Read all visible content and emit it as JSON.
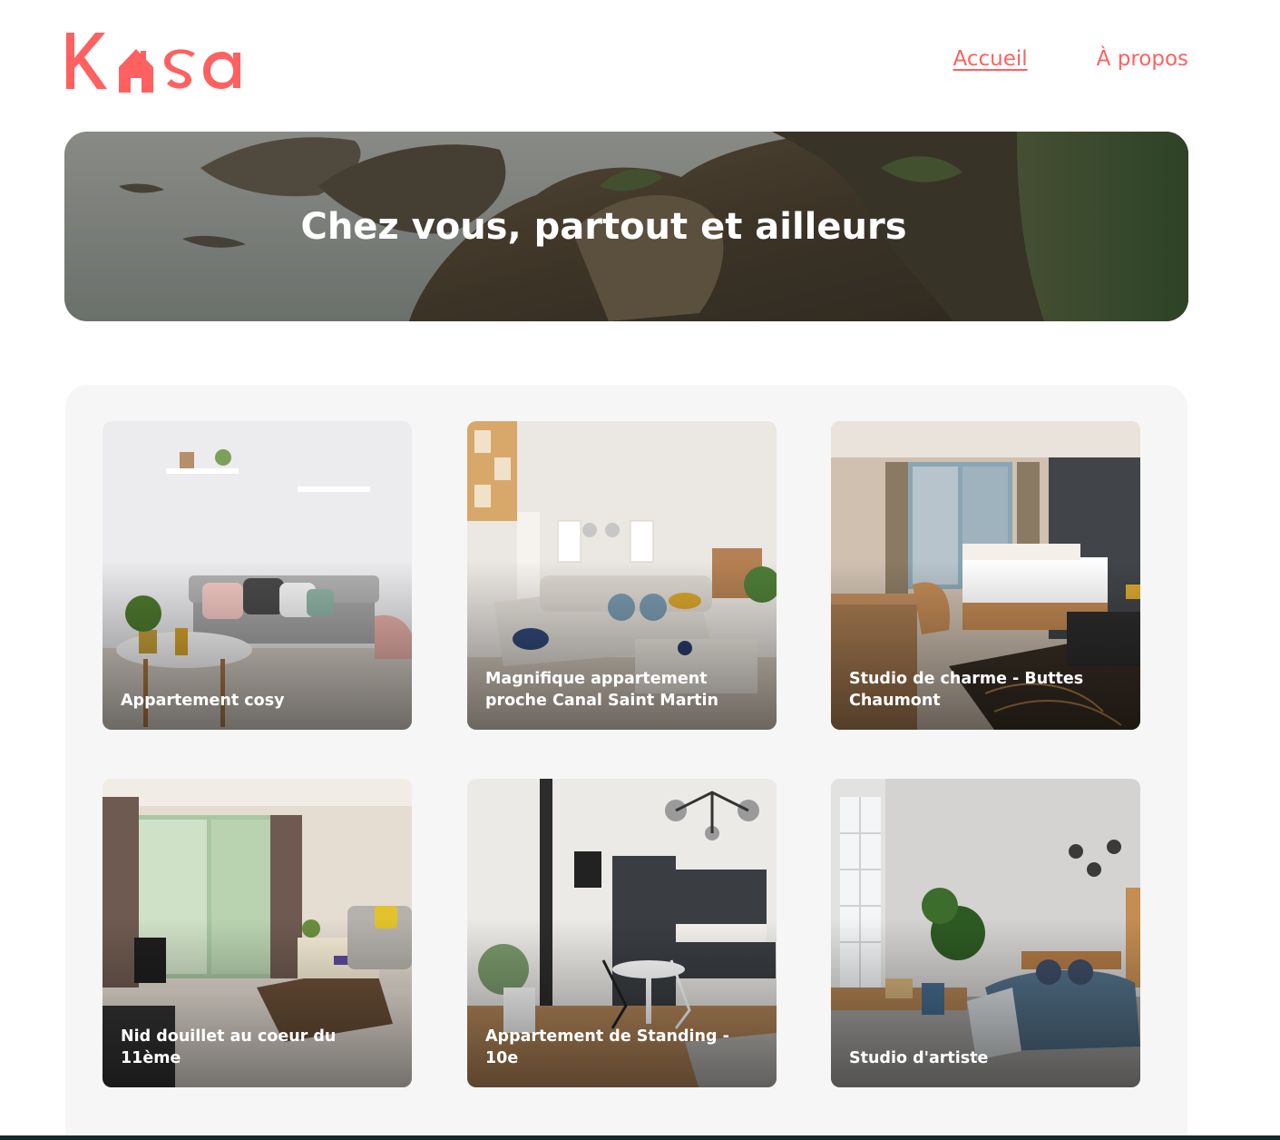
{
  "brand": {
    "name": "Kasa",
    "color": "#FF6060"
  },
  "nav": [
    {
      "label": "Accueil",
      "active": true
    },
    {
      "label": "À propos",
      "active": false
    }
  ],
  "banner": {
    "title": "Chez vous, partout et ailleurs"
  },
  "listings": [
    {
      "title": "Appartement cosy"
    },
    {
      "title": "Magnifique appartement proche Canal Saint Martin"
    },
    {
      "title": "Studio de charme - Buttes Chaumont"
    },
    {
      "title": "Nid douillet au coeur du 11ème"
    },
    {
      "title": "Appartement de Standing - 10e"
    },
    {
      "title": "Studio d'artiste"
    }
  ]
}
